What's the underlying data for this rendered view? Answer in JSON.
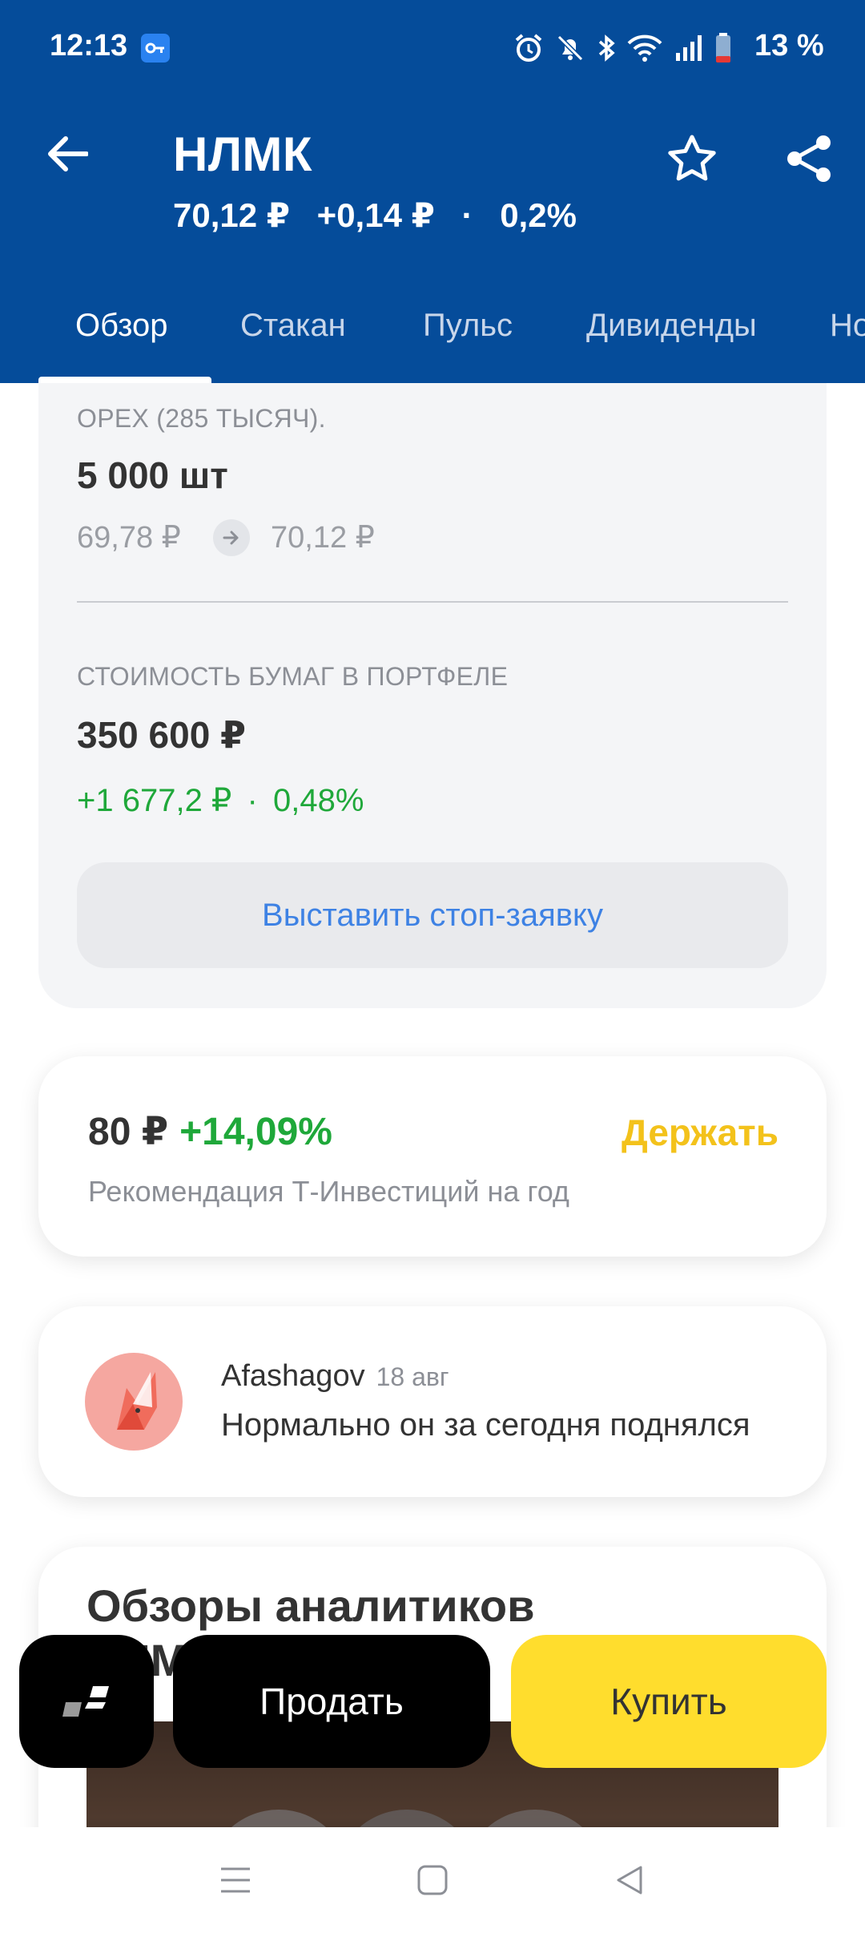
{
  "status_bar": {
    "time": "12:13",
    "battery": "13 %"
  },
  "header": {
    "title": "НЛМК",
    "price": "70,12 ₽",
    "change_abs": "+0,14 ₽",
    "separator": "·",
    "change_pct": "0,2%"
  },
  "tabs": [
    {
      "label": "Обзор",
      "active": true
    },
    {
      "label": "Стакан",
      "active": false
    },
    {
      "label": "Пульс",
      "active": false
    },
    {
      "label": "Дивиденды",
      "active": false
    },
    {
      "label": "Но",
      "active": false
    }
  ],
  "position": {
    "caption_top": "OPEX (285 ТЫСЯЧ).",
    "quantity": "5 000 шт",
    "avg_price": "69,78 ₽",
    "current_price": "70,12 ₽",
    "value_caption": "СТОИМОСТЬ БУМАГ В ПОРТФЕЛЕ",
    "value": "350 600 ₽",
    "gain_abs": "+1 677,2 ₽",
    "gain_sep": "·",
    "gain_pct": "0,48%",
    "stop_button": "Выставить стоп-заявку"
  },
  "recommendation": {
    "target_price": "80 ₽",
    "upside": "+14,09%",
    "verdict": "Держать",
    "subtitle": "Рекомендация Т-Инвестиций на год"
  },
  "pulse_post": {
    "author": "Afashagov",
    "date": "18 авг",
    "text": "Нормально он за сегодня поднялся"
  },
  "analysts": {
    "title_line1": "Обзоры аналитиков",
    "title_line2": "НЛМК"
  },
  "actions": {
    "sell": "Продать",
    "buy": "Купить"
  },
  "colors": {
    "header_bg": "#054c9a",
    "positive": "#1fa83a",
    "hold": "#f3c21b",
    "buy_button": "#ffdd2d",
    "link": "#3e82e4"
  }
}
